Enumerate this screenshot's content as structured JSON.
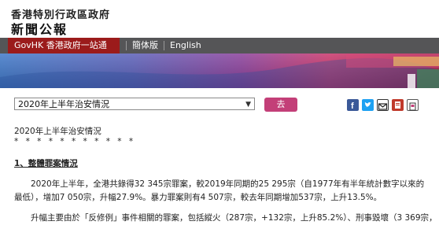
{
  "header": {
    "org": "香港特別行政區政府",
    "title": "新聞公報"
  },
  "nav": {
    "govhk": "GovHK 香港政府一站通",
    "traditional": "簡体版",
    "english": "English"
  },
  "toolbar": {
    "select_value": "2020年上半年治安情況",
    "go_label": "去",
    "share_icons": [
      "facebook-icon",
      "twitter-icon",
      "email-icon",
      "print-icon",
      "bookmark-icon"
    ]
  },
  "article": {
    "heading": "2020年上半年治安情況",
    "stars": "* * * * * * * * * * *",
    "section": "1、整體罪案情況",
    "para1": "2020年上半年，全港共錄得32 345宗罪案，較2019年同期的25 295宗（自1977年有半年統計數字以來的最低），增加7 050宗，升幅27.9%。暴力罪案則有4 507宗，較去年同期增加537宗，上升13.5%。",
    "para2": "升幅主要由於「反修例」事件相關的罪案，包括縱火（287宗，+132宗，上升85.2%）、刑事毀壞（3 369宗，"
  },
  "colors": {
    "gov_red": "#9b1b1b",
    "go_button": "#c33f78"
  }
}
